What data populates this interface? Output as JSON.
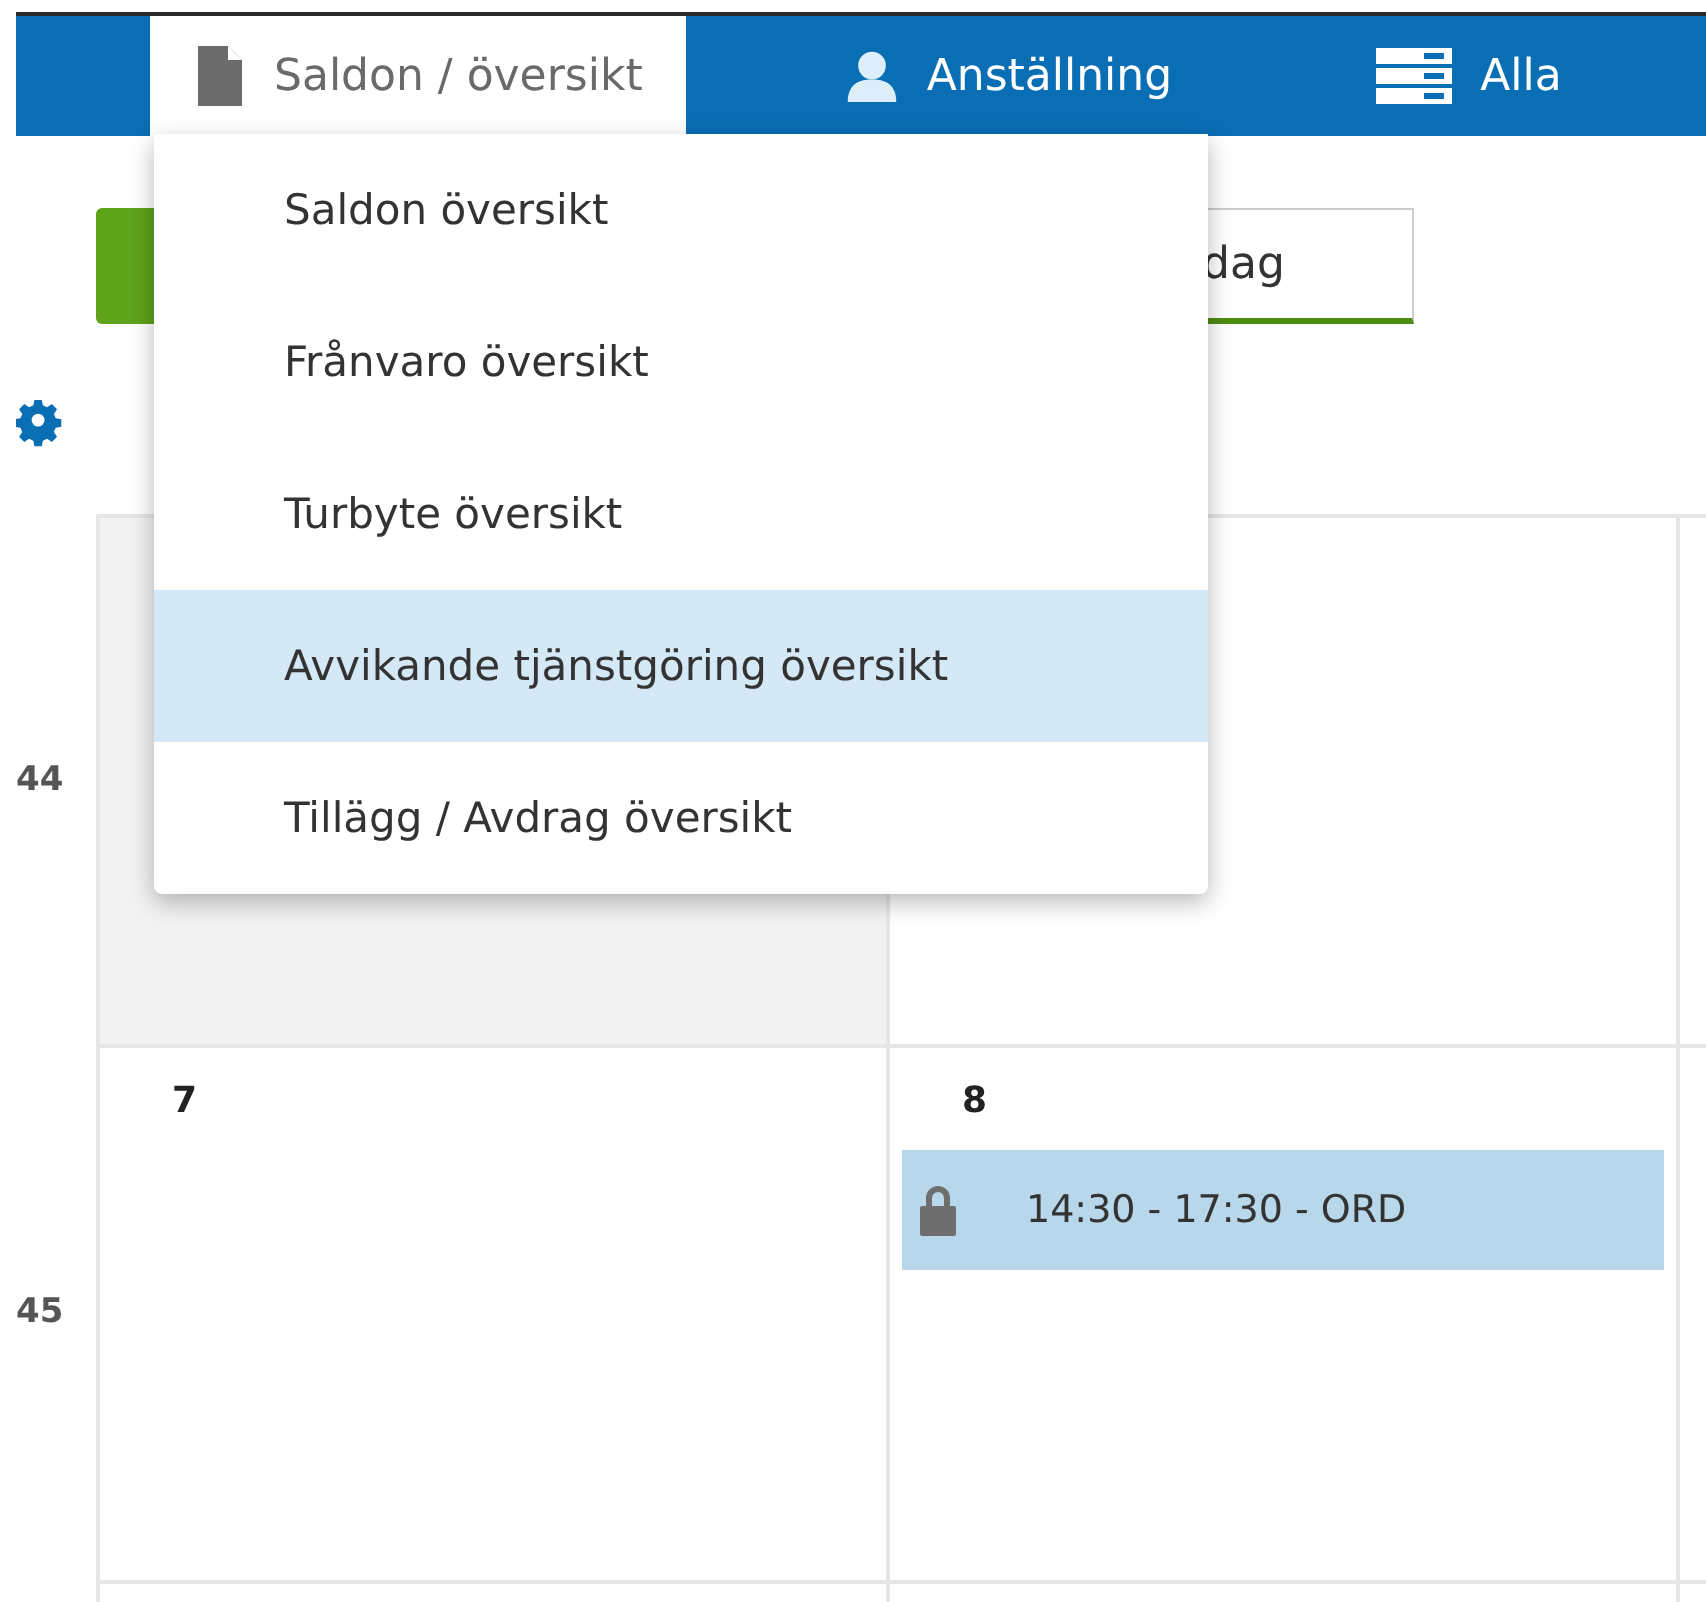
{
  "nav": {
    "items": [
      {
        "label": "Saldon / översikt",
        "kind": "document",
        "selected": true
      },
      {
        "label": "Anställning",
        "kind": "person",
        "selected": false
      },
      {
        "label": "Alla",
        "kind": "list",
        "selected": false
      }
    ]
  },
  "dropdown": {
    "items": [
      {
        "label": "Saldon översikt",
        "highlighted": false
      },
      {
        "label": "Frånvaro översikt",
        "highlighted": false
      },
      {
        "label": "Turbyte översikt",
        "highlighted": false
      },
      {
        "label": "Avvikande tjänstgöring översikt",
        "highlighted": true
      },
      {
        "label": "Tillägg / Avdrag översikt",
        "highlighted": false
      }
    ]
  },
  "toolbar": {
    "today_button": "dag"
  },
  "calendar": {
    "weeks": [
      {
        "number": "44",
        "days": [
          {
            "muted": true
          },
          {
            "muted": false
          },
          {
            "muted": false
          }
        ]
      },
      {
        "number": "45",
        "days": [
          {
            "day": "7",
            "muted": false
          },
          {
            "day": "8",
            "muted": false,
            "events": [
              {
                "time": "14:30 - 17:30 - ORD",
                "locked": true
              }
            ]
          },
          {
            "muted": false
          }
        ]
      },
      {
        "days": [
          {
            "muted": false
          },
          {
            "muted": false
          },
          {
            "muted": false
          }
        ]
      }
    ]
  }
}
